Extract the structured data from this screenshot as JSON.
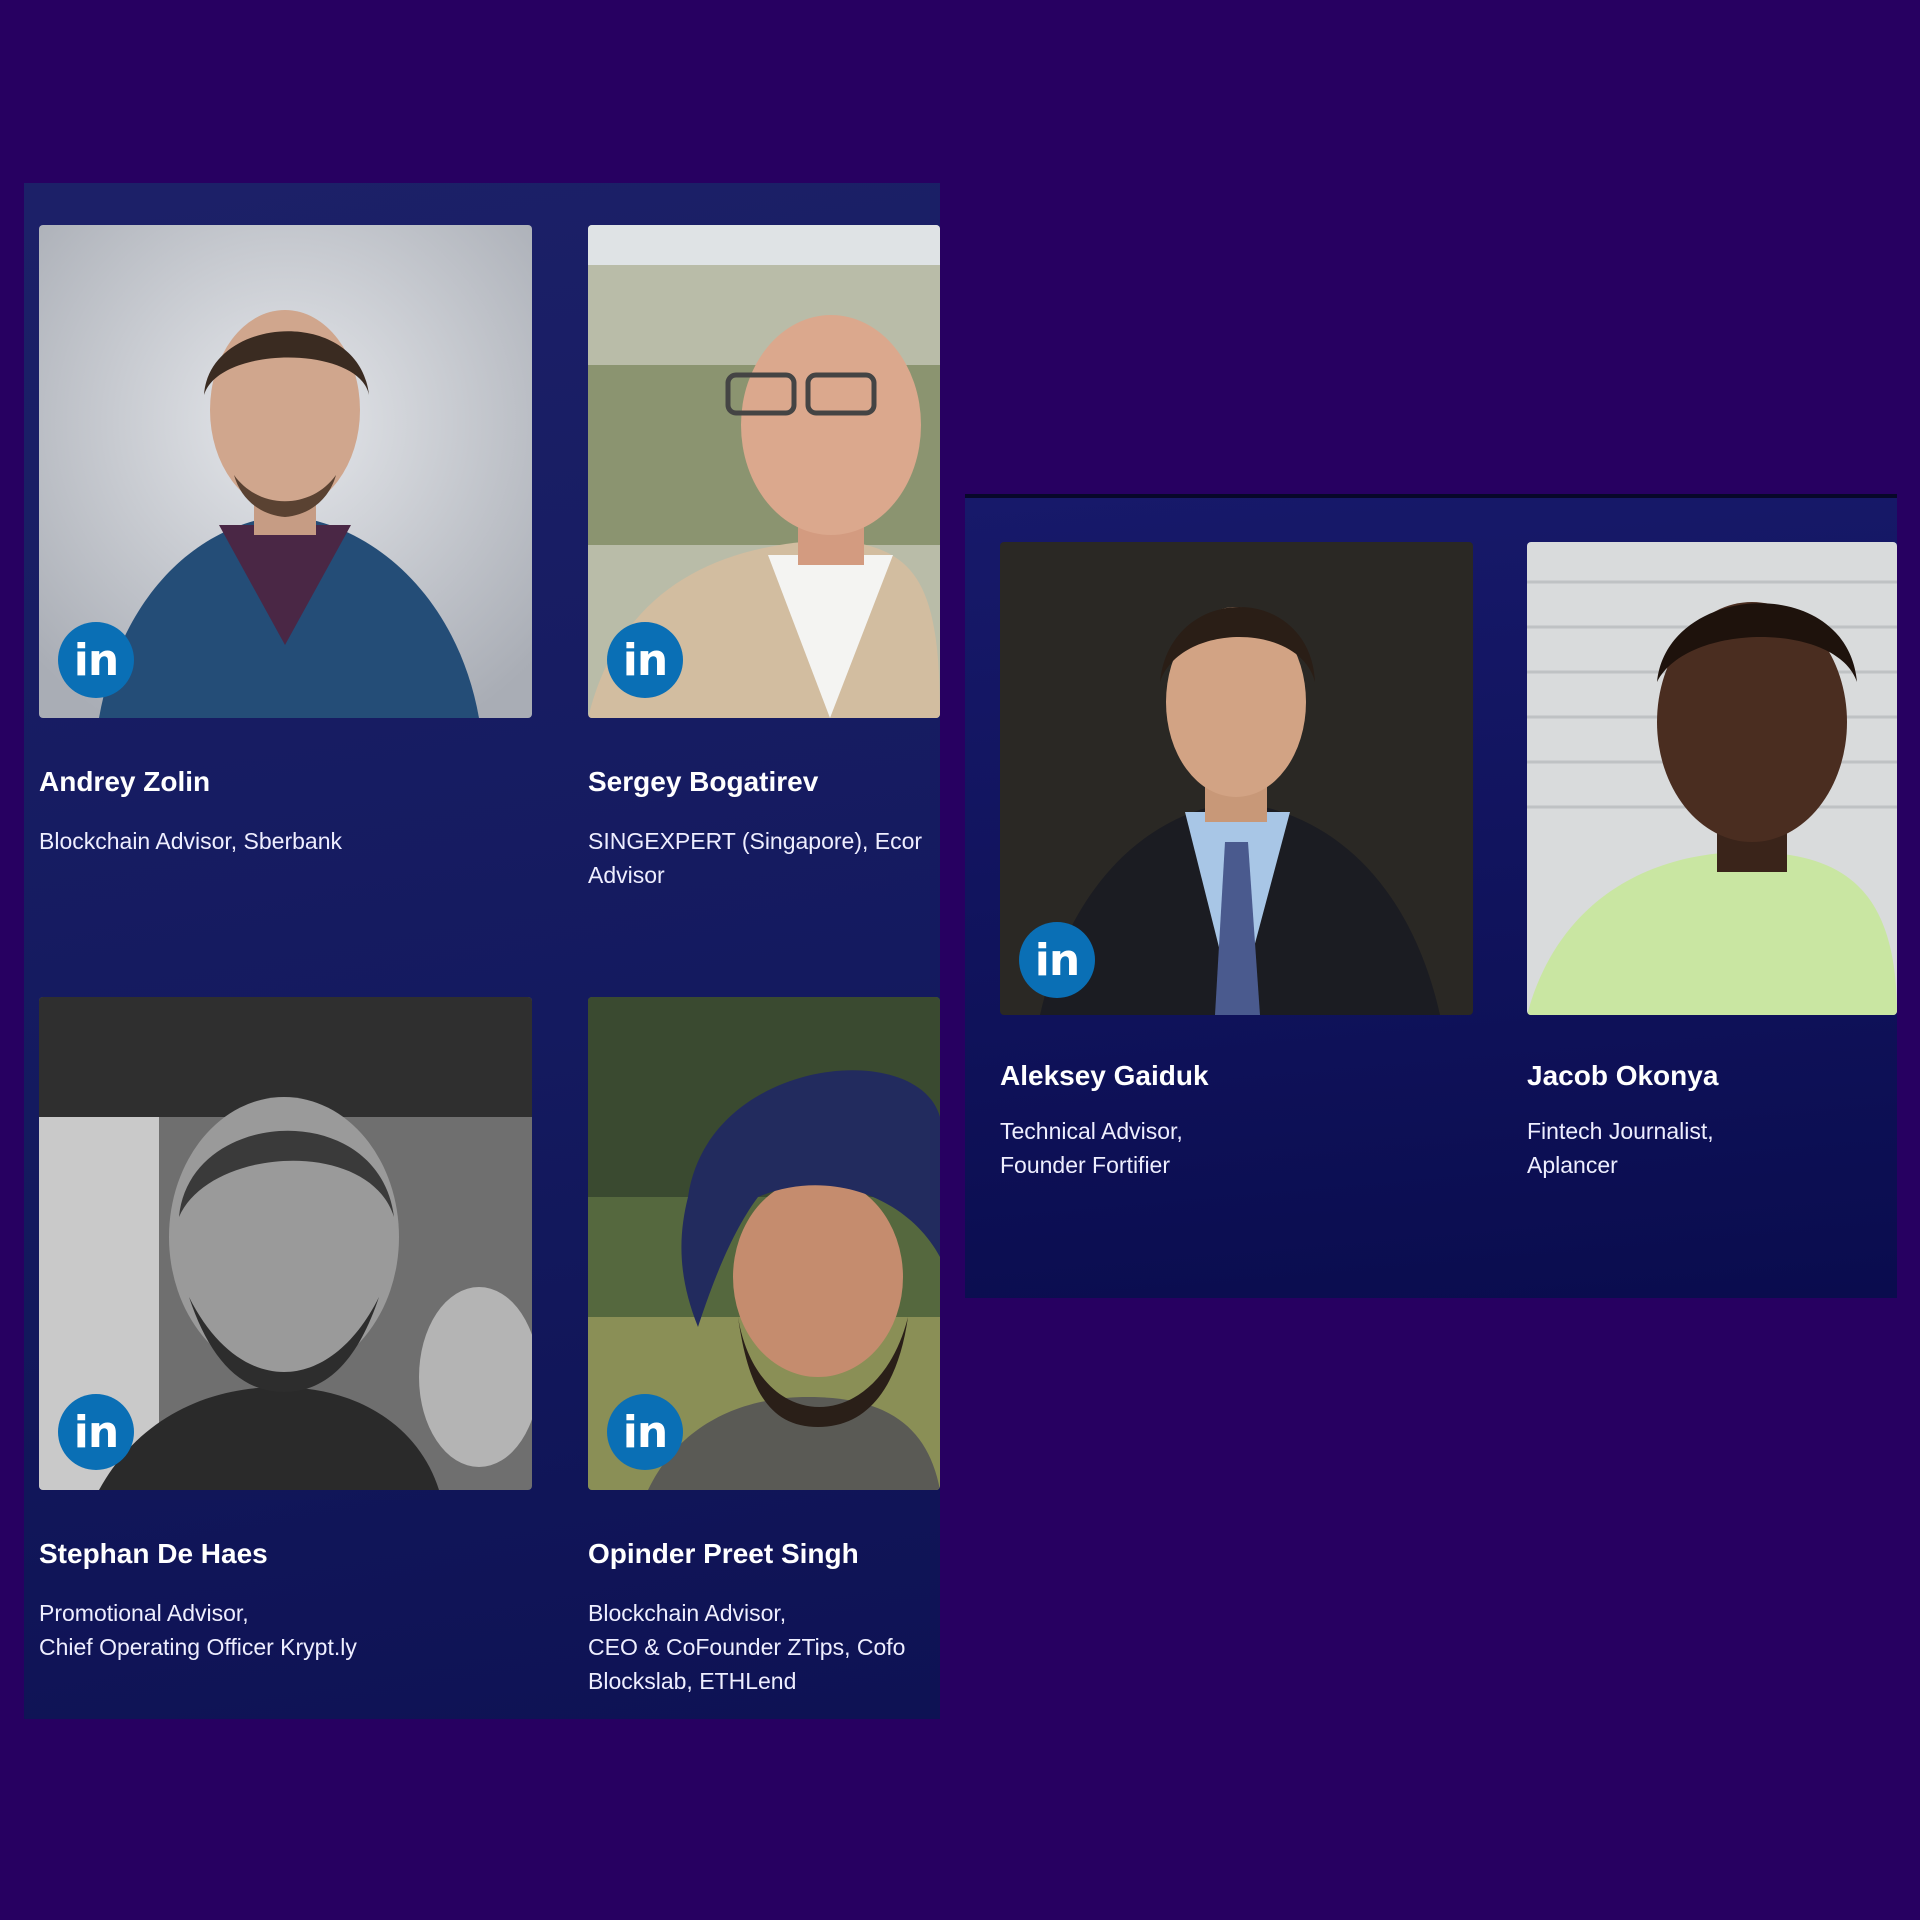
{
  "linkedin_label": "in",
  "left_panel": {
    "advisors": [
      {
        "name": "Andrey Zolin",
        "role_lines": [
          "Blockchain Advisor, Sberbank"
        ]
      },
      {
        "name": "Sergey Bogatirev",
        "role_lines": [
          "SINGEXPERT (Singapore), Ecor",
          "Advisor"
        ]
      },
      {
        "name": "Stephan De Haes",
        "role_lines": [
          "Promotional Advisor,",
          "Chief Operating Officer Krypt.ly"
        ]
      },
      {
        "name": "Opinder Preet Singh",
        "role_lines": [
          "Blockchain Advisor,",
          "CEO & CoFounder ZTips, Cofo",
          "Blockslab, ETHLend"
        ]
      }
    ]
  },
  "right_panel": {
    "advisors": [
      {
        "name": "Aleksey Gaiduk",
        "role_lines": [
          "Technical Advisor,",
          "Founder Fortifier"
        ]
      },
      {
        "name": "Jacob Okonya",
        "role_lines": [
          "Fintech Journalist,",
          "Aplancer"
        ]
      }
    ]
  },
  "colors": {
    "background": "#270061",
    "panel": "#141a5f",
    "linkedin": "#0a6fb5"
  }
}
